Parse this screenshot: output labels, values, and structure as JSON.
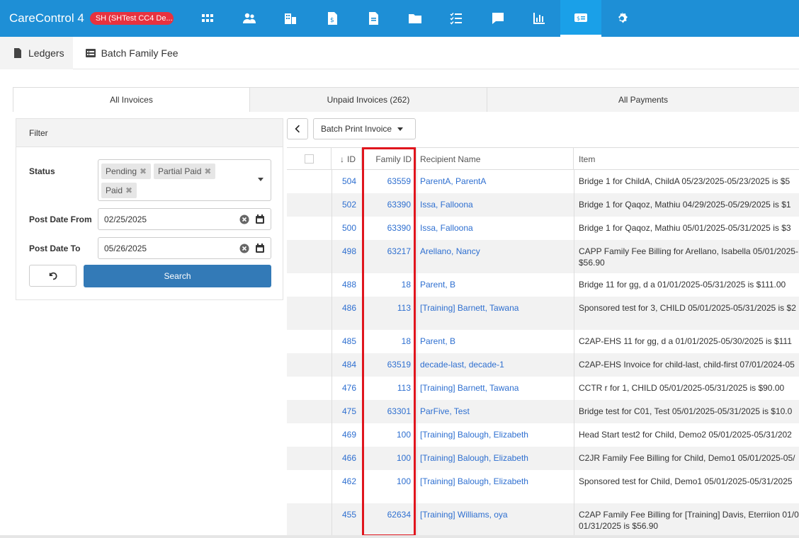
{
  "app": {
    "title": "CareControl 4",
    "env_badge": "SH (SHTest CC4 De..."
  },
  "nav": {
    "icons": [
      "apps-icon",
      "people-icon",
      "building-icon",
      "invoice-icon",
      "document-icon",
      "folder-icon",
      "checklist-icon",
      "chat-icon",
      "report-chart-icon",
      "billing-icon",
      "gear-icon"
    ],
    "active_index": 9
  },
  "breadcrumb": {
    "items": [
      "Ledgers",
      "Batch Family Fee"
    ]
  },
  "tabs": [
    {
      "label": "All Invoices",
      "active": true
    },
    {
      "label": "Unpaid Invoices (262)",
      "active": false
    },
    {
      "label": "All Payments",
      "active": false
    }
  ],
  "filter": {
    "header": "Filter",
    "status_label": "Status",
    "status_chips": [
      "Pending",
      "Partial Paid",
      "Paid"
    ],
    "post_from_label": "Post Date From",
    "post_from_value": "02/25/2025",
    "post_to_label": "Post Date To",
    "post_to_value": "05/26/2025",
    "search_label": "Search"
  },
  "toolbar": {
    "batch_print_label": "Batch Print Invoice"
  },
  "table": {
    "columns": [
      "ID",
      "Family ID",
      "Recipient Name",
      "Item"
    ],
    "rows": [
      {
        "id": "504",
        "family_id": "63559",
        "recipient": "ParentA, ParentA",
        "item": "Bridge 1 for ChildA, ChildA 05/23/2025-05/23/2025 is $5",
        "item2": ""
      },
      {
        "id": "502",
        "family_id": "63390",
        "recipient": "Issa, Falloona",
        "item": "Bridge 1 for Qaqoz, Mathiu 04/29/2025-05/29/2025 is $1",
        "item2": ""
      },
      {
        "id": "500",
        "family_id": "63390",
        "recipient": "Issa, Falloona",
        "item": "Bridge 1 for Qaqoz, Mathiu 05/01/2025-05/31/2025 is $3",
        "item2": ""
      },
      {
        "id": "498",
        "family_id": "63217",
        "recipient": "Arellano, Nancy",
        "item": "CAPP Family Fee Billing for Arellano, Isabella 05/01/2025-",
        "item2": "$56.90"
      },
      {
        "id": "488",
        "family_id": "18",
        "recipient": "Parent, B",
        "item": "Bridge 11 for gg, d a 01/01/2025-05/31/2025 is $111.00",
        "item2": ""
      },
      {
        "id": "486",
        "family_id": "113",
        "recipient": "[Training] Barnett, Tawana",
        "item": "Sponsored test for 3, CHILD 05/01/2025-05/31/2025 is $2",
        "item2": ""
      },
      {
        "id": "485",
        "family_id": "18",
        "recipient": "Parent, B",
        "item": "C2AP-EHS 11 for gg, d a 01/01/2025-05/30/2025 is $111",
        "item2": ""
      },
      {
        "id": "484",
        "family_id": "63519",
        "recipient": "decade-last, decade-1",
        "item": "C2AP-EHS Invoice for child-last, child-first 07/01/2024-05",
        "item2": ""
      },
      {
        "id": "476",
        "family_id": "113",
        "recipient": "[Training] Barnett, Tawana",
        "item": "CCTR r for 1, CHILD 05/01/2025-05/31/2025 is $90.00",
        "item2": ""
      },
      {
        "id": "475",
        "family_id": "63301",
        "recipient": "ParFive, Test",
        "item": "Bridge test for C01, Test 05/01/2025-05/31/2025 is $10.0",
        "item2": ""
      },
      {
        "id": "469",
        "family_id": "100",
        "recipient": "[Training] Balough, Elizabeth",
        "item": "Head Start test2 for Child, Demo2 05/01/2025-05/31/202",
        "item2": ""
      },
      {
        "id": "466",
        "family_id": "100",
        "recipient": "[Training] Balough, Elizabeth",
        "item": "C2JR Family Fee Billing for Child, Demo1 05/01/2025-05/",
        "item2": ""
      },
      {
        "id": "462",
        "family_id": "100",
        "recipient": "[Training] Balough, Elizabeth",
        "item": "Sponsored test for Child, Demo1 05/01/2025-05/31/2025",
        "item2": ""
      },
      {
        "id": "455",
        "family_id": "62634",
        "recipient": "[Training] Williams, oya",
        "item": "C2AP Family Fee Billing for [Training] Davis, Eterriion 01/0",
        "item2": "01/31/2025 is $56.90"
      }
    ]
  },
  "colors": {
    "topbar": "#1e8fd6",
    "badge": "#e8323f",
    "search_button": "#337ab7",
    "link": "#2e6fd0",
    "highlight": "#e0151d"
  }
}
